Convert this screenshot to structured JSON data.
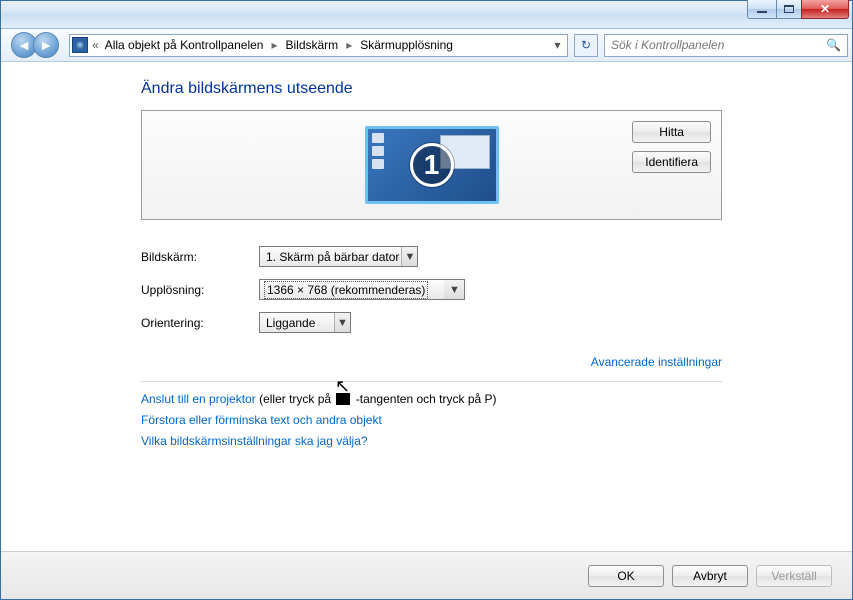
{
  "window": {
    "search_placeholder": "Sök i Kontrollpanelen"
  },
  "breadcrumb": {
    "root": "Alla objekt på Kontrollpanelen",
    "mid": "Bildskärm",
    "leaf": "Skärmupplösning"
  },
  "page": {
    "title": "Ändra bildskärmens utseende",
    "monitor_number": "1",
    "btn_find": "Hitta",
    "btn_identify": "Identifiera"
  },
  "form": {
    "display_label": "Bildskärm:",
    "display_value": "1. Skärm på bärbar dator",
    "resolution_label": "Upplösning:",
    "resolution_value": "1366 × 768 (rekommenderas)",
    "orientation_label": "Orientering:",
    "orientation_value": "Liggande"
  },
  "links": {
    "advanced": "Avancerade inställningar",
    "projector_link": "Anslut till en projektor",
    "projector_rest_a": " (eller tryck på ",
    "projector_rest_b": " -tangenten och tryck på P)",
    "text_size": "Förstora eller förminska text och andra objekt",
    "which": "Vilka bildskärmsinställningar ska jag välja?"
  },
  "footer": {
    "ok": "OK",
    "cancel": "Avbryt",
    "apply": "Verkställ"
  }
}
